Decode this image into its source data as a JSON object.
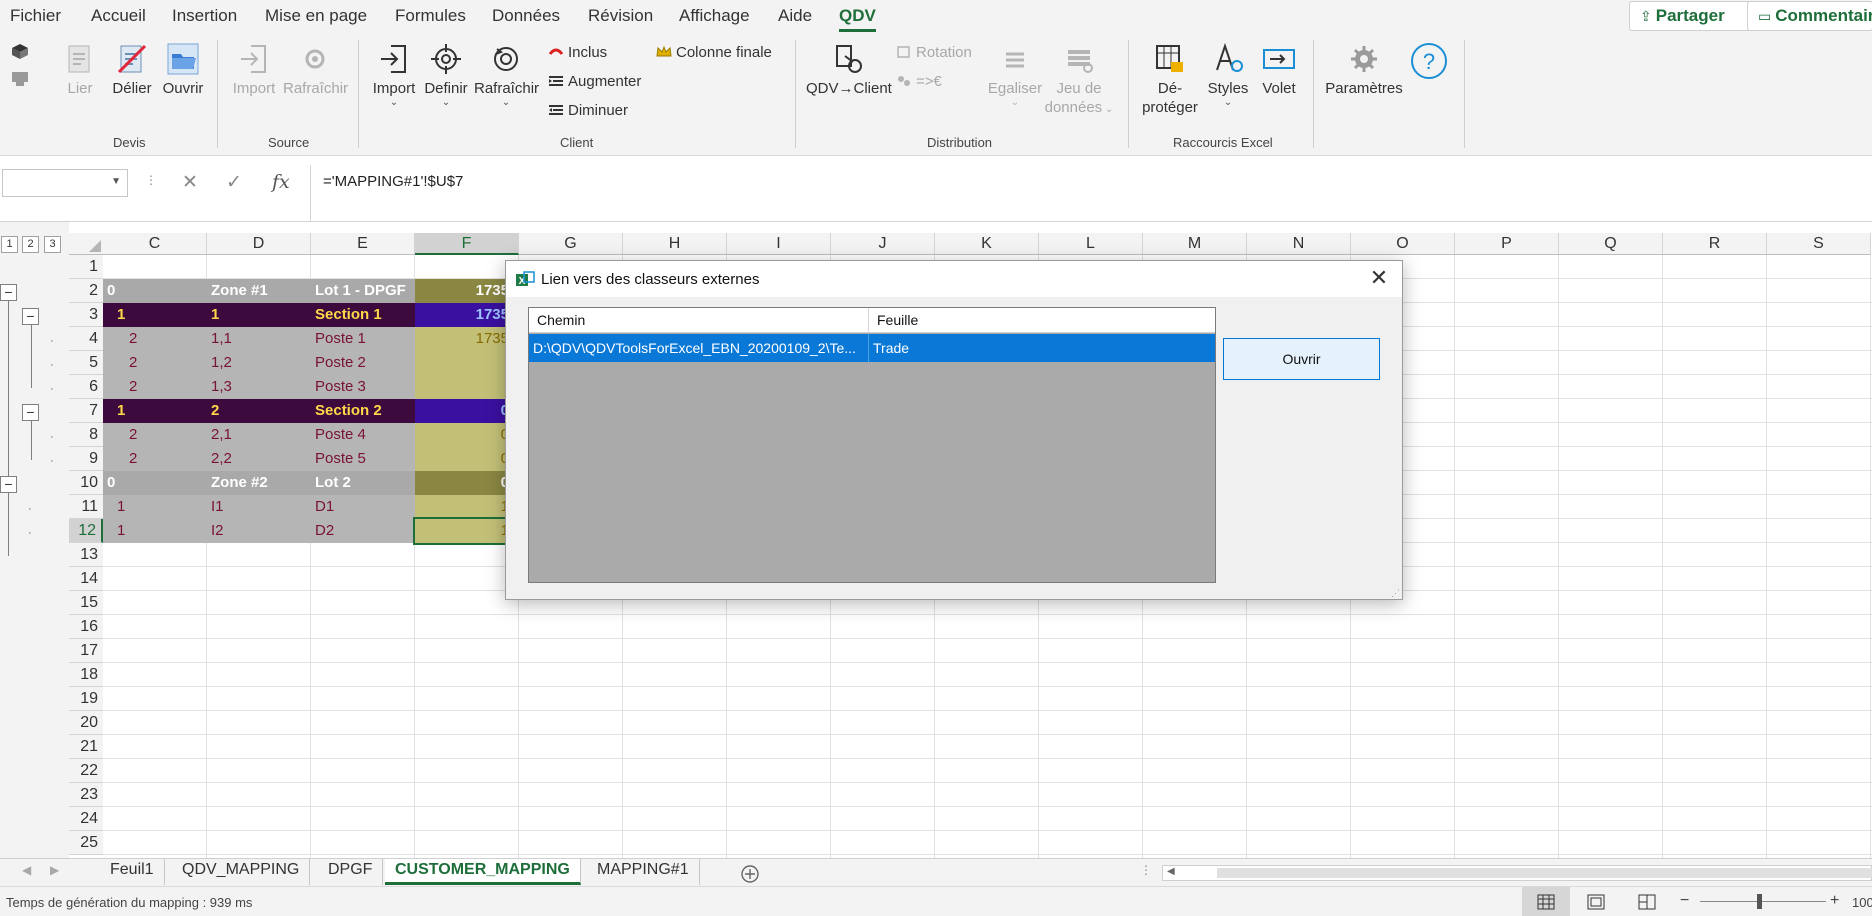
{
  "menubar": {
    "tabs": [
      "Fichier",
      "Accueil",
      "Insertion",
      "Mise en page",
      "Formules",
      "Données",
      "Révision",
      "Affichage",
      "Aide",
      "QDV"
    ],
    "share_label": "Partager",
    "comments_label": "Commentaires"
  },
  "ribbon": {
    "devis": {
      "label": "Devis",
      "lier": "Lier",
      "delier": "Délier",
      "ouvrir": "Ouvrir"
    },
    "source": {
      "label": "Source",
      "import": "Import",
      "rafraichir": "Rafraîchir"
    },
    "client": {
      "label": "Client",
      "import": "Import",
      "definir": "Definir",
      "rafraichir": "Rafraîchir",
      "inclus": "Inclus",
      "augmenter": "Augmenter",
      "diminuer": "Diminuer",
      "colonne_finale": "Colonne finale"
    },
    "distribution": {
      "label": "Distribution",
      "qdv_client": "QDV→Client",
      "rotation": "Rotation",
      "to_euro": "=>€",
      "egaliser": "Egaliser",
      "jeu_line1": "Jeu de",
      "jeu_line2": "données"
    },
    "raccourcis": {
      "label": "Raccourcis Excel",
      "deproteger_line1": "Dé-",
      "deproteger_line2": "protéger",
      "styles": "Styles",
      "volet": "Volet"
    },
    "parametres": "Paramètres"
  },
  "formula_bar": {
    "name_box": "",
    "formula": "='MAPPING#1'!$U$7"
  },
  "grid": {
    "columns": [
      "C",
      "D",
      "E",
      "F",
      "G",
      "H",
      "I",
      "J",
      "K",
      "L",
      "M",
      "N",
      "O",
      "P",
      "Q",
      "R",
      "S"
    ],
    "selected_column": "F",
    "row_numbers": [
      "1",
      "2",
      "3",
      "4",
      "5",
      "6",
      "7",
      "8",
      "9",
      "10",
      "11",
      "12",
      "13",
      "14",
      "15",
      "16",
      "17",
      "18",
      "19",
      "20",
      "21",
      "22",
      "23",
      "24",
      "25"
    ],
    "selected_row": "12",
    "outline_levels": [
      "1",
      "2",
      "3"
    ],
    "rows": [
      {
        "row": "2",
        "c": "0",
        "d": "Zone #1",
        "e": "Lot 1 - DPGF",
        "f": "1735"
      },
      {
        "row": "3",
        "c": "1",
        "d": "1",
        "e": "Section 1",
        "f": "1735"
      },
      {
        "row": "4",
        "c": "2",
        "d": "1,1",
        "e": "Poste 1",
        "f": "1735"
      },
      {
        "row": "5",
        "c": "2",
        "d": "1,2",
        "e": "Poste 2",
        "f": ""
      },
      {
        "row": "6",
        "c": "2",
        "d": "1,3",
        "e": "Poste 3",
        "f": ""
      },
      {
        "row": "7",
        "c": "1",
        "d": "2",
        "e": "Section 2",
        "f": "0"
      },
      {
        "row": "8",
        "c": "2",
        "d": "2,1",
        "e": "Poste 4",
        "f": "0"
      },
      {
        "row": "9",
        "c": "2",
        "d": "2,2",
        "e": "Poste 5",
        "f": "0"
      },
      {
        "row": "10",
        "c": "0",
        "d": "Zone #2",
        "e": "Lot 2",
        "f": "0"
      },
      {
        "row": "11",
        "c": "1",
        "d": "I1",
        "e": "D1",
        "f": "1"
      },
      {
        "row": "12",
        "c": "1",
        "d": "I2",
        "e": "D2",
        "f": "1"
      }
    ]
  },
  "sheets": {
    "tabs": [
      "Feuil1",
      "QDV_MAPPING",
      "DPGF",
      "CUSTOMER_MAPPING",
      "MAPPING#1"
    ],
    "active": "CUSTOMER_MAPPING"
  },
  "status": {
    "text": "Temps de génération du mapping : 939 ms",
    "zoom": "100"
  },
  "dialog": {
    "title": "Lien vers des classeurs externes",
    "columns": [
      "Chemin",
      "Feuille"
    ],
    "rows": [
      {
        "path": "D:\\QDV\\QDVToolsForExcel_EBN_20200109_2\\Te...",
        "sheet": "Trade"
      }
    ],
    "open_label": "Ouvrir"
  },
  "colors": {
    "accent_green": "#1e6e3a",
    "zone_row": "#a9a9a9",
    "section_row": "#3c0a3c",
    "selection_blue": "#0a78d7",
    "olive": "#8a8743",
    "olive_light": "#c2c077"
  }
}
